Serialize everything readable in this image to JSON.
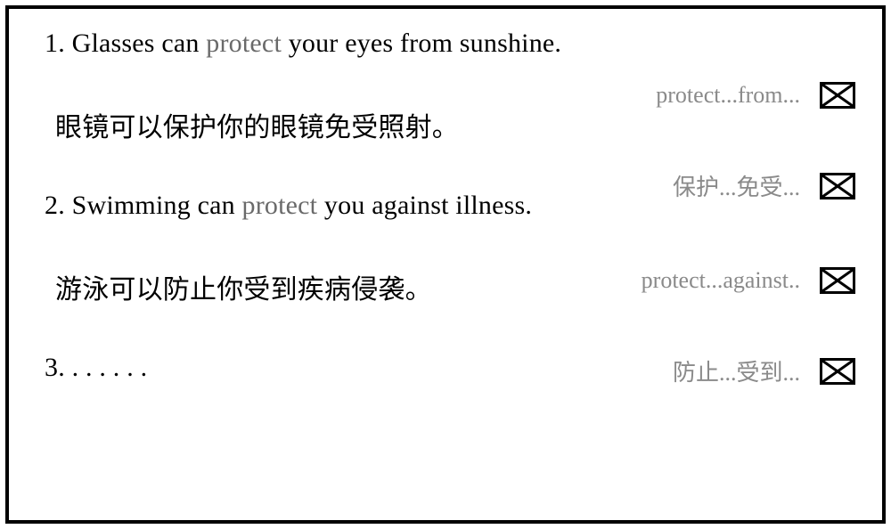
{
  "items": [
    {
      "num": "1.",
      "pre": " Glasses can ",
      "highlight": "protect",
      "post": " your eyes from sunshine."
    },
    {
      "num": "",
      "pre": "眼镜可以保护你的眼镜免受照射。",
      "highlight": "",
      "post": ""
    },
    {
      "num": "2.",
      "pre": " Swimming can ",
      "highlight": "protect",
      "post": " you against illness."
    },
    {
      "num": "",
      "pre": "游泳可以防止你受到疾病侵袭。",
      "highlight": "",
      "post": ""
    },
    {
      "num": "3.",
      "pre": " . . . . . .",
      "highlight": "",
      "post": ""
    }
  ],
  "annotations": [
    {
      "label": "protect...from..."
    },
    {
      "label": "保护...免受..."
    },
    {
      "label": "protect...against.."
    },
    {
      "label": "防止...受到..."
    }
  ]
}
